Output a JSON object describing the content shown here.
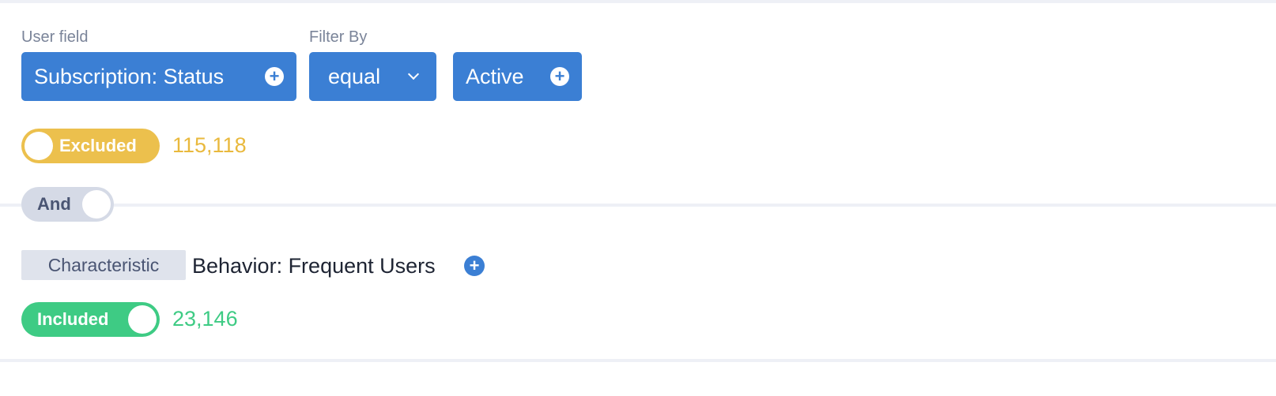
{
  "filter1": {
    "user_field_label": "User field",
    "filter_by_label": "Filter By",
    "field_value": "Subscription: Status",
    "operator": "equal",
    "value": "Active",
    "toggle_label": "Excluded",
    "count": "115,118"
  },
  "logic": {
    "operator_label": "And"
  },
  "filter2": {
    "tag_label": "Characteristic",
    "name": "Behavior: Frequent Users",
    "toggle_label": "Included",
    "count": "23,146"
  },
  "icons": {
    "plus": "+",
    "chevron": "chevron-down"
  },
  "colors": {
    "accent": "#3b7fd4",
    "excluded": "#ecc04d",
    "included": "#3ecb84",
    "and_toggle": "#d5dae6"
  }
}
